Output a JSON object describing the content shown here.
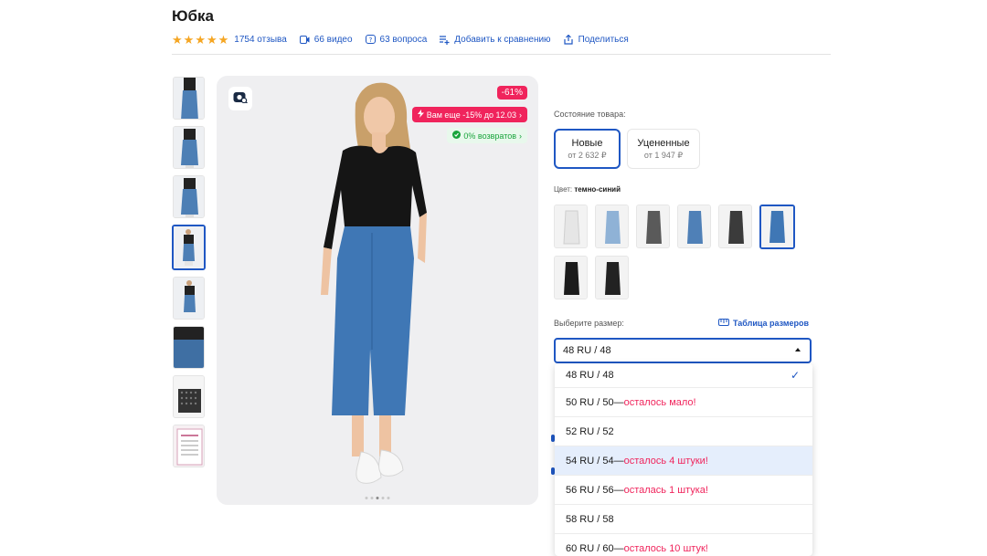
{
  "product": {
    "title": "Юбка",
    "reviews": "1754 отзыва",
    "videos": "66 видео",
    "questions": "63 вопроса",
    "compare": "Добавить к сравнению",
    "share": "Поделиться",
    "rating_stars": 5
  },
  "photo": {
    "discount": "-61%",
    "promo": "Вам еще -15% до 12.03",
    "returns": "0% возвратов"
  },
  "condition": {
    "label": "Состояние товара:",
    "options": [
      {
        "name": "Новые",
        "price": "от 2 632 ₽",
        "selected": true
      },
      {
        "name": "Уцененные",
        "price": "от 1 947 ₽",
        "selected": false
      }
    ]
  },
  "color": {
    "label": "Цвет:",
    "value": "темно-синий"
  },
  "size": {
    "label": "Выберите размер:",
    "table_link": "Таблица размеров",
    "selected": "48 RU / 48",
    "options": [
      {
        "label": "48 RU / 48",
        "note": "",
        "checked": true
      },
      {
        "label": "50 RU / 50—",
        "note": "осталось мало!"
      },
      {
        "label": "52 RU / 52",
        "note": ""
      },
      {
        "label": "54 RU / 54—",
        "note": "осталось 4 штуки!",
        "highlighted": true
      },
      {
        "label": "56 RU / 56—",
        "note": "осталась 1 штука!"
      },
      {
        "label": "58 RU / 58",
        "note": ""
      },
      {
        "label": "60 RU / 60—",
        "note": "осталось 10 штук!"
      }
    ]
  },
  "colors": {
    "accent": "#1f57c3",
    "warning": "#f0245c",
    "star": "#f5a623"
  }
}
